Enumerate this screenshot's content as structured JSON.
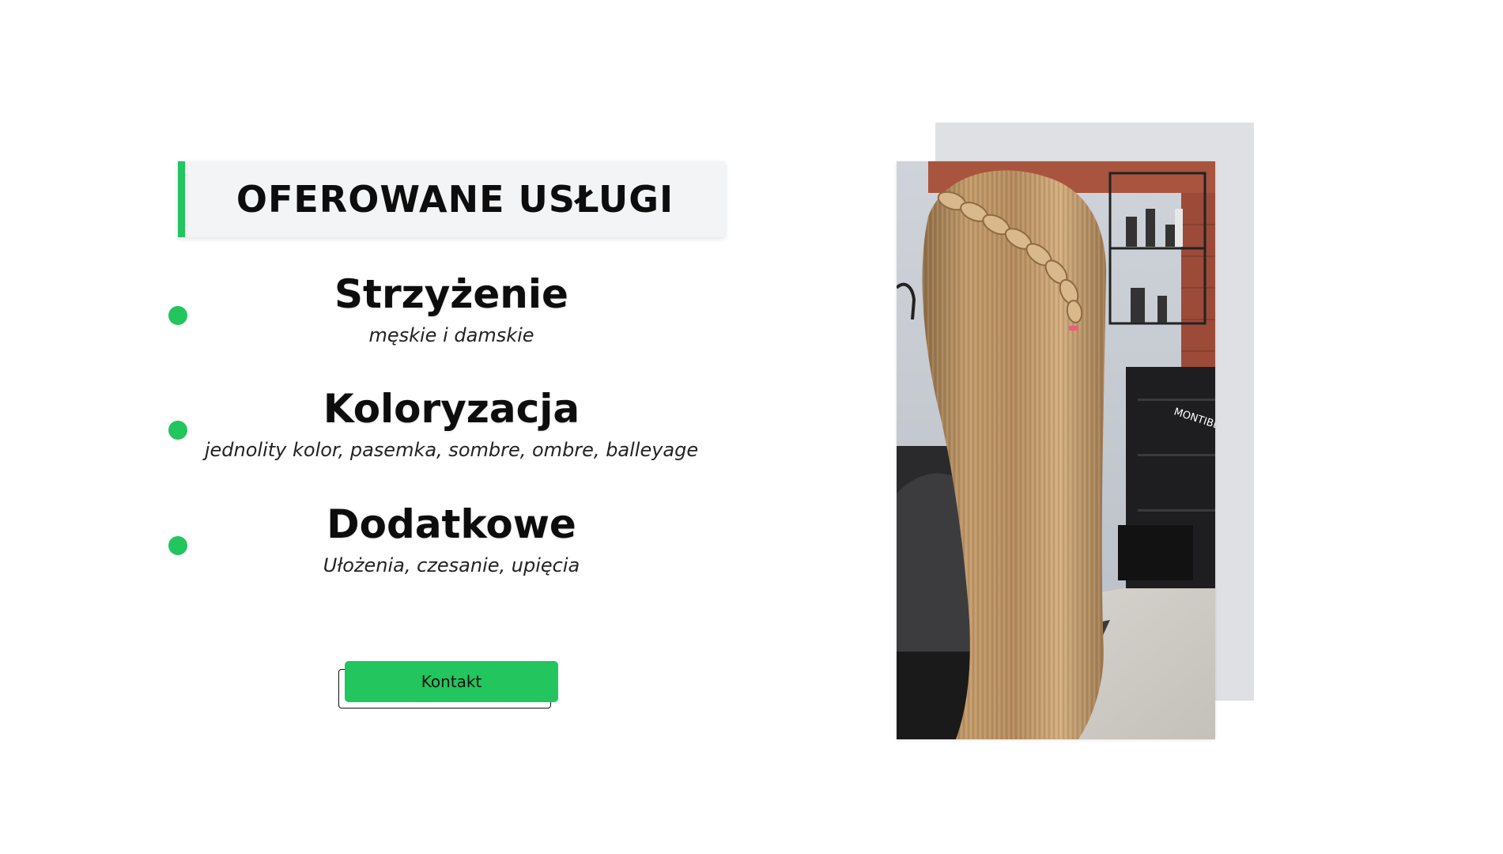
{
  "heading": {
    "title": "OFEROWANE USŁUGI"
  },
  "services": [
    {
      "title": "Strzyżenie",
      "description": "męskie i damskie"
    },
    {
      "title": "Koloryzacja",
      "description": "jednolity kolor, pasemka, sombre, ombre, balleyage"
    },
    {
      "title": "Dodatkowe",
      "description": "Ułożenia, czesanie, upięcia"
    }
  ],
  "contact_button": {
    "label": "Kontakt"
  },
  "photo": {
    "alt": "Długie jasne włosy z warkoczem",
    "shelf_text": "MONTIBE"
  },
  "colors": {
    "accent": "#22c55e",
    "heading_bg": "#f3f4f5",
    "backdrop": "#dfe0e3"
  }
}
